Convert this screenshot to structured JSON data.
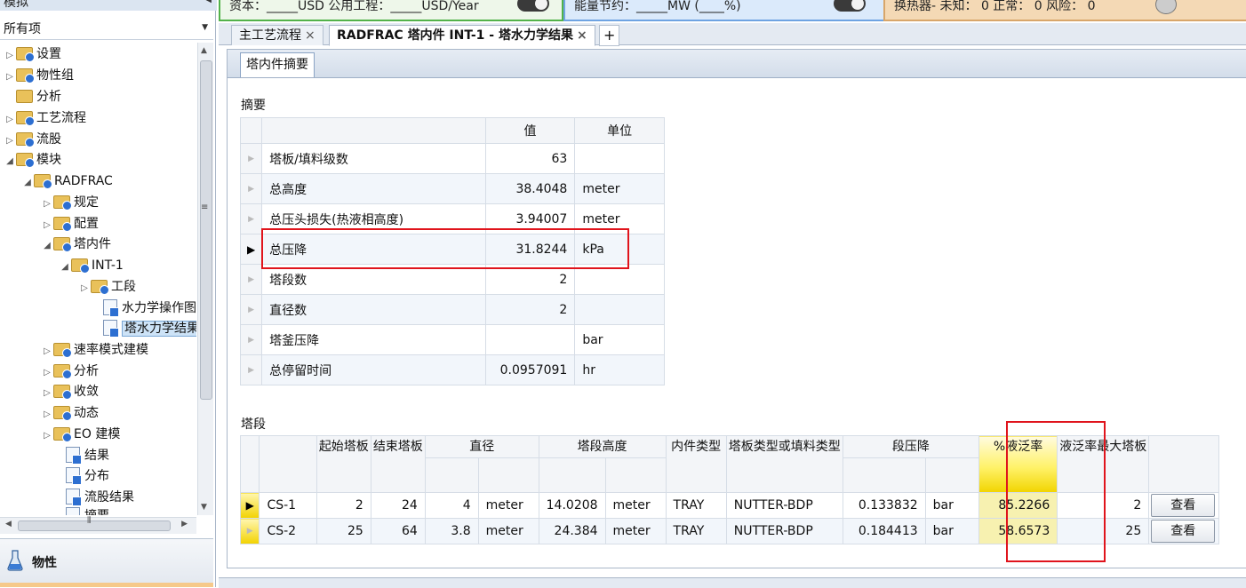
{
  "nav": {
    "header": "模拟",
    "filter_value": "所有项",
    "tree": [
      {
        "label": "设置"
      },
      {
        "label": "物性组"
      },
      {
        "label": "分析"
      },
      {
        "label": "工艺流程"
      },
      {
        "label": "流股"
      },
      {
        "label": "模块"
      },
      {
        "label": "RADFRAC"
      },
      {
        "label": "规定"
      },
      {
        "label": "配置"
      },
      {
        "label": "塔内件"
      },
      {
        "label": "INT-1"
      },
      {
        "label": "工段"
      },
      {
        "label": "水力学操作图"
      },
      {
        "label": "塔水力学结果"
      },
      {
        "label": "速率模式建模"
      },
      {
        "label": "分析"
      },
      {
        "label": "收敛"
      },
      {
        "label": "动态"
      },
      {
        "label": "EO 建模"
      },
      {
        "label": "结果"
      },
      {
        "label": "分布"
      },
      {
        "label": "流股结果"
      },
      {
        "label": "摘要"
      }
    ],
    "bottom_label": "物性"
  },
  "topbar": {
    "cost_text": "资本：_____USD   公用工程：_____USD/Year",
    "energy_text": "能量节约：_____MW    (____%)",
    "hx_text": "换热器-  未知：  0    正常：  0    风险：  0"
  },
  "tabs": {
    "tab1": "主工艺流程",
    "tab2": "RADFRAC 塔内件 INT-1 - 塔水力学结果",
    "add": "+"
  },
  "subtab": "塔内件摘要",
  "summary": {
    "title": "摘要",
    "col_value": "值",
    "col_unit": "单位",
    "rows": [
      {
        "label": "塔板/填料级数",
        "value": "63",
        "unit": ""
      },
      {
        "label": "总高度",
        "value": "38.4048",
        "unit": "meter"
      },
      {
        "label": "总压头损失(热液相高度)",
        "value": "3.94007",
        "unit": "meter"
      },
      {
        "label": "总压降",
        "value": "31.8244",
        "unit": "kPa"
      },
      {
        "label": "塔段数",
        "value": "2",
        "unit": ""
      },
      {
        "label": "直径数",
        "value": "2",
        "unit": ""
      },
      {
        "label": "塔釜压降",
        "value": "",
        "unit": "bar"
      },
      {
        "label": "总停留时间",
        "value": "0.0957091",
        "unit": "hr"
      }
    ]
  },
  "sections": {
    "title": "塔段",
    "headers": {
      "start": "起始塔板",
      "end": "结束塔板",
      "diameter": "直径",
      "height": "塔段高度",
      "internal_type": "内件类型",
      "tray_type": "塔板类型或填料类型",
      "pressure_drop": "段压降",
      "flood": "%液泛率",
      "max_flood": "液泛率最大塔板"
    },
    "rows": [
      {
        "name": "CS-1",
        "start": "2",
        "end": "24",
        "diameter": "4",
        "diameter_unit": "meter",
        "height": "14.0208",
        "height_unit": "meter",
        "internal_type": "TRAY",
        "tray_type": "NUTTER-BDP",
        "pressure_drop": "0.133832",
        "pd_unit": "bar",
        "flood": "85.2266",
        "max_flood": "2",
        "button": "查看"
      },
      {
        "name": "CS-2",
        "start": "25",
        "end": "64",
        "diameter": "3.8",
        "diameter_unit": "meter",
        "height": "24.384",
        "height_unit": "meter",
        "internal_type": "TRAY",
        "tray_type": "NUTTER-BDP",
        "pressure_drop": "0.184413",
        "pd_unit": "bar",
        "flood": "58.6573",
        "max_flood": "25",
        "button": "查看"
      }
    ]
  },
  "colors": {
    "highlight_box": "#e0141c",
    "flood_highlight": "#fff26a"
  }
}
